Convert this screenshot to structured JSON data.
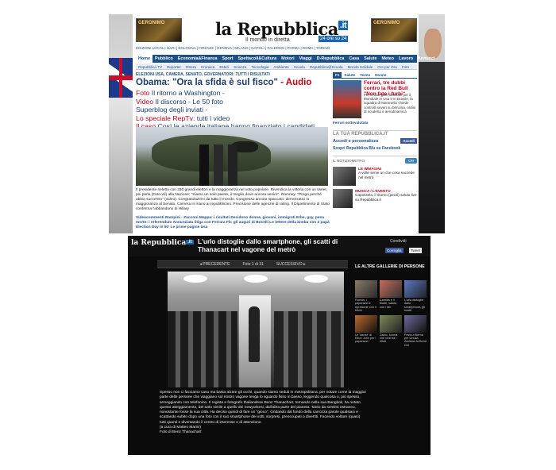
{
  "page1": {
    "ad_left": "GERONIMO",
    "ad_right": "GERONIMO",
    "logo": "la Repubblica",
    "logo_it": ".it",
    "tagline": "Il mondo in diretta",
    "badge": "24 ore su 24",
    "editions": "EDIZIONI LOCALI: BARI | BOLOGNA | FIRENZE | GENOVA | MILANO | NAPOLI | PALERMO | PARMA | ROMA | TORINO",
    "nav": [
      "Home",
      "Pubblico",
      "Economia&Finanza",
      "Sport",
      "Spettacoli&Cultura",
      "Motori",
      "Viaggi",
      "D-Repubblica",
      "Casa",
      "Salute",
      "Meteo",
      "Lavoro",
      "Annunci"
    ],
    "subnav": [
      "Repubblica TV",
      "Reporter",
      "RSera",
      "Cronaca",
      "Esteri",
      "Scienze",
      "Tecnologia",
      "Ambiente",
      "Scuola",
      "Repubblica@Scuola",
      "Mondo Solidale",
      "Ore per Ora",
      "Foto"
    ],
    "kicker": "ELEZIONI USA, CAMERA, SENATO, GOVERNATORI: TUTTI I RISULTATI",
    "headline": "Obama: \"Ora la sfida è sul fisco\"",
    "headline_audio": " - Audio",
    "sublinks": [
      {
        "red": "Foto",
        "text": " Il ritorno a Washington - "
      },
      {
        "red": "Video",
        "text": " Il discorso - Le 50 foto"
      },
      {
        "red": "",
        "text": "Superblog degli inviati - "
      },
      {
        "red": "Lo speciale RepTv",
        "text": ": tutti i video"
      },
      {
        "red": "Il caso",
        "text": " Così le aziende italiane hanno finanziato i candidati"
      },
      {
        "red": "Il blog",
        "text": " L'abbraccio (vecchio) di Barack divide twitter"
      }
    ],
    "caption": "Il presidente rieletto con 330 grandi elettori e la maggioranza nel voto popolare. Rivendica la vittoria con un tweet, poi parla (Foto-vd) alla Nazione: \"Siamo un solo paese, il meglio deve ancora venire\". Romney: \"Prego perché abbia successo\" (video). Congratulazioni da tutto il mondo. Congresso ancora spaccato: democratici in maggioranza al Senato, Camera in mano ai repubblicani. Precisione delle agenzie di rating. Il Dipartimento di Stato conferma l'abbandono di Hillary",
    "bullets": "Videocommenti Rampini · Zucconi   Mappa: i risultati   Decidono donne, giovani, immigrati   Erbe, gay, pena morte: i referendum   Annunziata litiga con Ferrara   Fb: gli auguri di Bocelli   Le lettere della bimba con 2 papà   Election Day in 50'   Le prime pagine Usa",
    "side_tabs": [
      "F1",
      "Salute",
      "Teens",
      "Donne"
    ],
    "f1_title": "Ferrari, tre dubbi contro la Red Bull \"Non fate i furbi\"",
    "f1_text": "Per le due gare decisive per il Mondiale in Usa e in Brasile, la squadra di Maranello chiede controlli severi su benzina, ordini di scuderia e aerodinamica",
    "f1_link": "Ferrari sottovalutata",
    "tua": "LA TUA REPUBBLICA.IT",
    "login": "Accedi e personalizza",
    "fb_btn": "Accedi",
    "blu": "Scopri Repubblica Blu su Facebook",
    "noti": "IL NOTIZIOMETRO",
    "noti_toggle": "ON",
    "mini1_label": "LE IMMAGINI",
    "mini1_text": "A volte serve un che cosa succede nel metrò",
    "mini2_label": "MUSICA / L'EVENTO",
    "mini2_text": "Capossela, il ritorno (pezzi) saluto live su Repubblica.it"
  },
  "page2": {
    "logo": "la Repubblica",
    "logo_it": ".it",
    "title": "L'urlo distoglie dallo smartphone, gli scatti di Thanacart nel vagone del metrò",
    "share": "Condividi",
    "fb": "Consiglia",
    "tw": "Tweet",
    "prev": "◂ PRECEDENTE",
    "counter": "Foto 1 di 31",
    "next": "SUCCESSIVO ▸",
    "body": "Spesso non ci facciamo caso ma basta alzare gli occhi, quando siamo seduti in metropolitana, per notare come la maggior parte delle persone che viaggiano sul nostro vagone tenga lo sguardo fisso in basso, leggendo qualcosa o, più spesso, armeggiando con telefonino. Il regista e fotografo thailandese Benz Thanachart, tornando nella sua Bangkok, ha notato questo atteggiamento, del tutto simile a quello dei newyorkesi, dall'altra parte del pianeta. Tanto da sentirsi estraneo, nonostante fosse la sua città. Ha deciso quindi di fare un \"gioco\". Gridando dal fondo della carrozza parole qualsiasi e scattando subito dopo una foto con il suo smartphone dei volti, sorpresi, preoccupati o divertiti. Facendo voltare (quasi) tutti quanti e diventando il centro di interesse e di attenzione.",
    "credit1": "(a cura di Matteo Marini)",
    "credit2": "Foto di Benz Thanachart",
    "side_title": "LE ALTRE GALLERIE DI PERSONE",
    "galleries": [
      "Florida, i paparazzi e ripresione con il bikini",
      "Camilla e il finale, saluta con i fan",
      "L'urlo distoglie dallo smartphone, gli scatti",
      "Le 'danze' di Elton John per i paparazzi",
      "Zarko, fuoma che vive tra i rifiuti",
      "Festa a Berna per Ursula Andress la Bond Girl"
    ]
  }
}
